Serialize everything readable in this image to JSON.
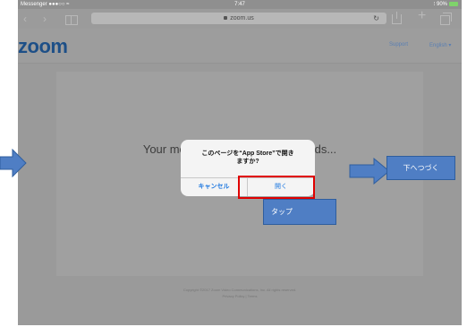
{
  "status_bar": {
    "left": "Messenger ●●●○○ ≈",
    "time": "7:47",
    "right": "⁝ 90%"
  },
  "browser": {
    "url": "zoom.us",
    "back_icon": "chevron-left-icon",
    "forward_icon": "chevron-right-icon",
    "bookmarks_icon": "book-icon",
    "reload_icon": "reload-icon",
    "share_icon": "share-icon",
    "add_tab_icon": "plus-icon",
    "tabs_icon": "tabs-icon"
  },
  "zoom": {
    "logo": "zoom",
    "support": "Support",
    "language": "English ▾",
    "launch_message": "Your meeting will launch in seconds...",
    "copyright": "Copyright ©2017 Zoom Video Communications, Inc. All rights reserved.",
    "footer_links": "Privacy Policy | Terms"
  },
  "dialog": {
    "message_line1": "このページを“App Store”で開き",
    "message_line2": "ますか?",
    "cancel": "キャンセル",
    "open": "開く"
  },
  "annotations": {
    "tap": "タップ",
    "continue": "下へつづく"
  },
  "colors": {
    "accent": "#1e78e0",
    "callout": "#4f7ec4",
    "highlight": "#e00000",
    "zoom_brand": "#1d4f87"
  }
}
